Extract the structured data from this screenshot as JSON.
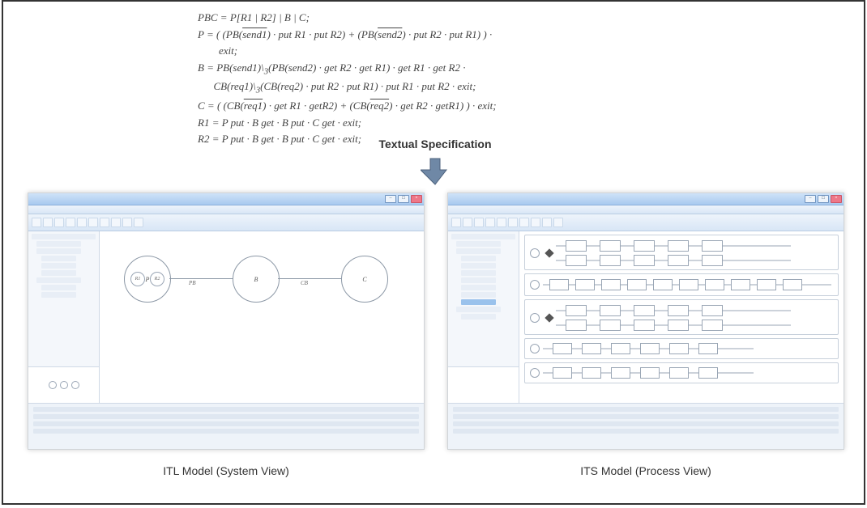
{
  "spec": {
    "lines": [
      "PBC = P[R1 | R2] | B | C;",
      "P = ( (PB(<span class=\"overline\">send1</span>) · put R1 · put R2) + (PB(<span class=\"overline\">send2</span>) · put R2 · put R1) ) ·",
      "&nbsp;&nbsp;&nbsp;&nbsp;&nbsp;&nbsp;&nbsp;&nbsp;exit;",
      "B = PB(send1)\\<sub>3</sub>(PB(send2) · get R2 · get R1) · get R1 · get R2 ·",
      "&nbsp;&nbsp;&nbsp;&nbsp;&nbsp;&nbsp;CB(req1)\\<sub>3</sub>(CB(req2) · put R2 · put R1) · put R1 · put R2 · exit;",
      "C = ( (CB(<span class=\"overline\">req1</span>) · get R1 · getR2) + (CB(<span class=\"overline\">req2</span>) · get R2 · getR1) ) · exit;",
      "R1 = P put · B get · B put · C get · exit;",
      "R2 = P put · B get · B put · C get · exit;"
    ],
    "caption": "Textual Specification"
  },
  "itl": {
    "caption": "ITL Model (System View)",
    "nodes": {
      "P": "P",
      "B": "B",
      "C": "C",
      "R1": "R1",
      "R2": "R2"
    },
    "edges": {
      "PB": "PB",
      "CB": "CB"
    }
  },
  "its": {
    "caption": "ITS Model (Process View)"
  }
}
